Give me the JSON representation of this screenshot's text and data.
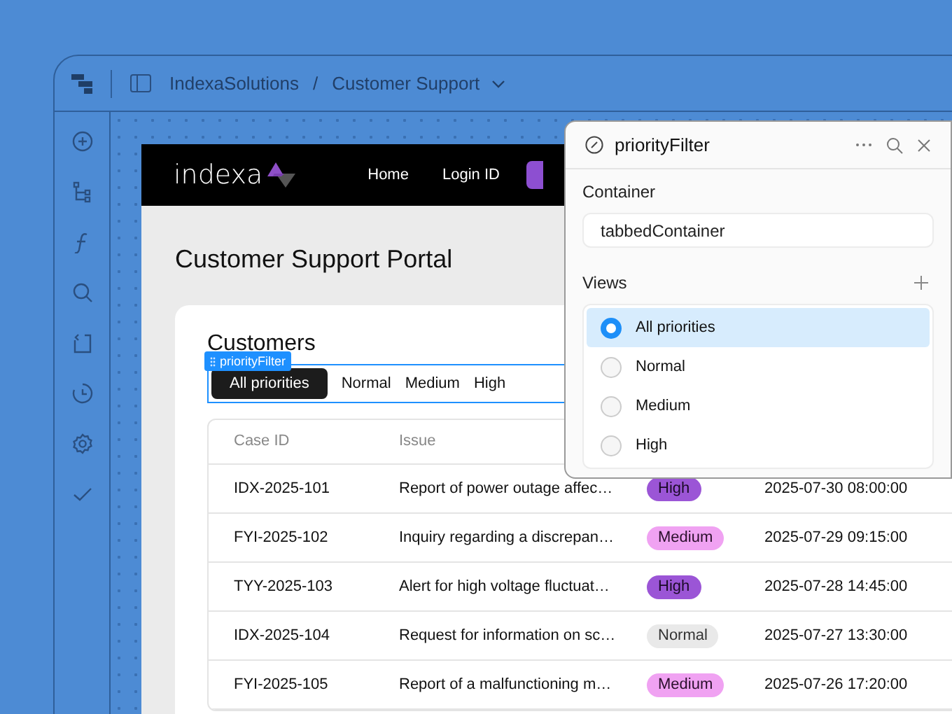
{
  "topbar": {
    "breadcrumb": [
      "IndexaSolutions",
      "Customer Support"
    ],
    "separator": "/"
  },
  "app": {
    "logo": "indexa",
    "nav": [
      "Home",
      "Login ID"
    ],
    "title": "Customer Support Portal",
    "card": {
      "title": "Customers",
      "selection_tag": "priorityFilter",
      "tabs": [
        {
          "label": "All priorities",
          "selected": true
        },
        {
          "label": "Normal",
          "selected": false
        },
        {
          "label": "Medium",
          "selected": false
        },
        {
          "label": "High",
          "selected": false
        }
      ],
      "table": {
        "columns": [
          "Case ID",
          "Issue"
        ],
        "rows": [
          {
            "case_id": "IDX-2025-101",
            "issue": "Report of power outage affec…",
            "priority": {
              "label": "High",
              "kind": "high"
            },
            "date": "2025-07-30 08:00:00"
          },
          {
            "case_id": "FYI-2025-102",
            "issue": "Inquiry regarding a discrepan…",
            "priority": {
              "label": "Medium",
              "kind": "medium"
            },
            "date": "2025-07-29 09:15:00"
          },
          {
            "case_id": "TYY-2025-103",
            "issue": "Alert for high voltage fluctuat…",
            "priority": {
              "label": "High",
              "kind": "high"
            },
            "date": "2025-07-28 14:45:00"
          },
          {
            "case_id": "IDX-2025-104",
            "issue": "Request for information on sc…",
            "priority": {
              "label": "Normal",
              "kind": "normal"
            },
            "date": "2025-07-27 13:30:00"
          },
          {
            "case_id": "FYI-2025-105",
            "issue": "Report of a malfunctioning m…",
            "priority": {
              "label": "Medium",
              "kind": "medium"
            },
            "date": "2025-07-26 17:20:00"
          }
        ]
      }
    }
  },
  "panel": {
    "title": "priorityFilter",
    "container_label": "Container",
    "container_value": "tabbedContainer",
    "views_label": "Views",
    "views": [
      {
        "label": "All priorities",
        "selected": true
      },
      {
        "label": "Normal",
        "selected": false
      },
      {
        "label": "Medium",
        "selected": false
      },
      {
        "label": "High",
        "selected": false
      }
    ]
  }
}
